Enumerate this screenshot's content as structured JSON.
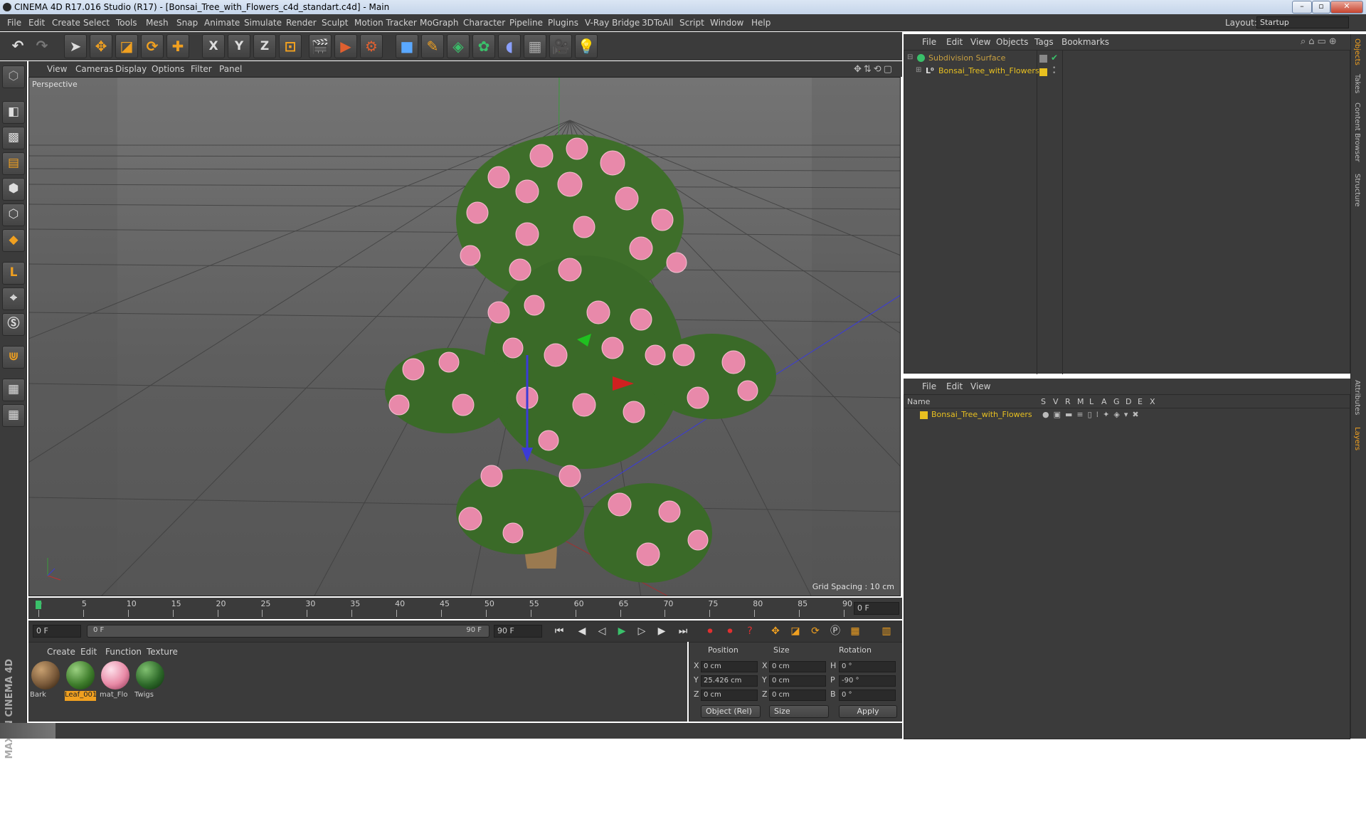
{
  "window": {
    "title": "CINEMA 4D R17.016 Studio (R17) - [Bonsai_Tree_with_Flowers_c4d_standart.c4d] - Main"
  },
  "menubar": [
    "File",
    "Edit",
    "Create",
    "Select",
    "Tools",
    "Mesh",
    "Snap",
    "Animate",
    "Simulate",
    "Render",
    "Sculpt",
    "Motion Tracker",
    "MoGraph",
    "Character",
    "Pipeline",
    "Plugins",
    "V-Ray Bridge",
    "3DToAll",
    "Script",
    "Window",
    "Help"
  ],
  "layout": {
    "label": "Layout:",
    "value": "Startup"
  },
  "axis_buttons": {
    "x": "X",
    "y": "Y",
    "z": "Z"
  },
  "viewport": {
    "menu": [
      "View",
      "Cameras",
      "Display",
      "Options",
      "Filter",
      "Panel"
    ],
    "label": "Perspective",
    "grid_spacing": "Grid Spacing : 10 cm"
  },
  "timeline": {
    "ticks": [
      "0",
      "5",
      "10",
      "15",
      "20",
      "25",
      "30",
      "35",
      "40",
      "45",
      "50",
      "55",
      "60",
      "65",
      "70",
      "75",
      "80",
      "85",
      "90"
    ],
    "current_frame": "0 F",
    "start_field": "0 F",
    "range_start": "0 F",
    "range_end": "90 F",
    "end_field": "90 F"
  },
  "materials": {
    "menu": [
      "Create",
      "Edit",
      "Function",
      "Texture"
    ],
    "items": [
      {
        "name": "Bark",
        "color": "#7a5a3a"
      },
      {
        "name": "Leaf_001",
        "color": "#3f7d2c"
      },
      {
        "name": "mat_Flo",
        "color": "#e88aa6"
      },
      {
        "name": "Twigs",
        "color": "#2e6a2a"
      }
    ]
  },
  "coordinates": {
    "headers": {
      "position": "Position",
      "size": "Size",
      "rotation": "Rotation"
    },
    "rows": [
      {
        "axis": "X",
        "pos": "0 cm",
        "saxis": "X",
        "size": "0 cm",
        "raxis": "H",
        "rot": "0 °"
      },
      {
        "axis": "Y",
        "pos": "25.426 cm",
        "saxis": "Y",
        "size": "0 cm",
        "raxis": "P",
        "rot": "-90 °"
      },
      {
        "axis": "Z",
        "pos": "0 cm",
        "saxis": "Z",
        "size": "0 cm",
        "raxis": "B",
        "rot": "0 °"
      }
    ],
    "mode": "Object (Rel)",
    "size_mode": "Size",
    "apply": "Apply"
  },
  "objects_panel": {
    "menu": [
      "File",
      "Edit",
      "View",
      "Objects",
      "Tags",
      "Bookmarks"
    ],
    "items": [
      {
        "name": "Subdivision Surface",
        "color": "#c8a040"
      },
      {
        "name": "Bonsai_Tree_with_Flowers",
        "color": "#e8c020"
      }
    ]
  },
  "layers_panel": {
    "menu": [
      "File",
      "Edit",
      "View"
    ],
    "header": "Name",
    "columns": [
      "S",
      "V",
      "R",
      "M",
      "L",
      "A",
      "G",
      "D",
      "E",
      "X"
    ],
    "items": [
      {
        "name": "Bonsai_Tree_with_Flowers",
        "color": "#e8c020"
      }
    ]
  },
  "side_tabs": [
    "Objects",
    "Takes",
    "Content Browser",
    "Structure",
    "Attributes",
    "Layers"
  ],
  "brand": "MAXON CINEMA 4D",
  "accent": "#f0a020"
}
